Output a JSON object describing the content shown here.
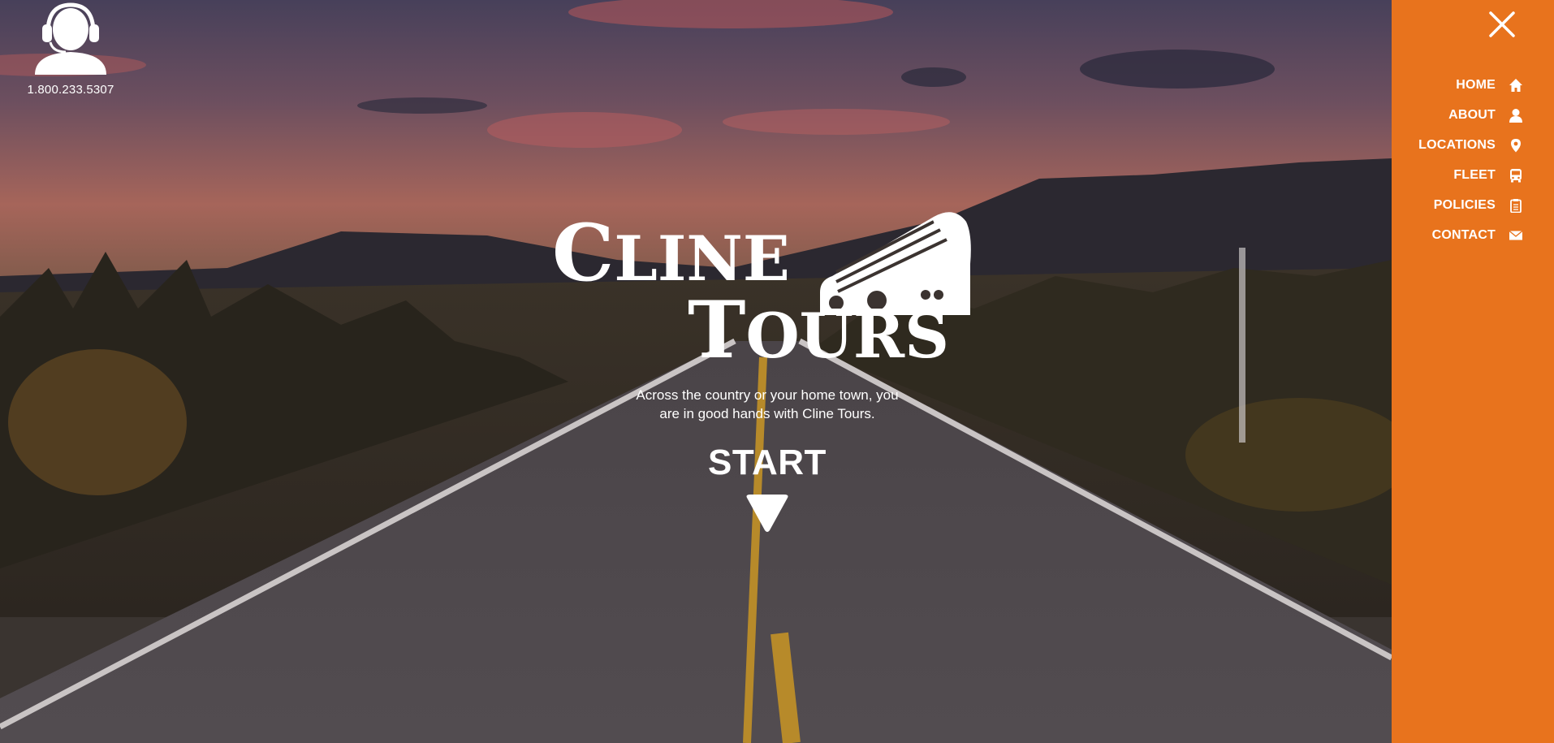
{
  "header": {
    "phone_number": "1.800.233.5307",
    "agent_icon": "headset-agent-icon"
  },
  "logo": {
    "line1_first": "C",
    "line1_rest": "LINE",
    "line2_first": "T",
    "line2_rest": "OURS",
    "icon": "tour-bus-icon"
  },
  "hero": {
    "tagline_line1": "Across the country or your home town, you",
    "tagline_line2": "are in good hands with Cline Tours.",
    "start_label": "START",
    "start_icon": "arrow-down-icon"
  },
  "nav": {
    "close_icon": "close-icon",
    "background_color": "#e8731d",
    "items": [
      {
        "label": "HOME",
        "icon": "home-icon"
      },
      {
        "label": "ABOUT",
        "icon": "user-icon"
      },
      {
        "label": "LOCATIONS",
        "icon": "map-pin-icon"
      },
      {
        "label": "FLEET",
        "icon": "bus-icon"
      },
      {
        "label": "POLICIES",
        "icon": "clipboard-icon"
      },
      {
        "label": "CONTACT",
        "icon": "envelope-icon"
      }
    ]
  }
}
